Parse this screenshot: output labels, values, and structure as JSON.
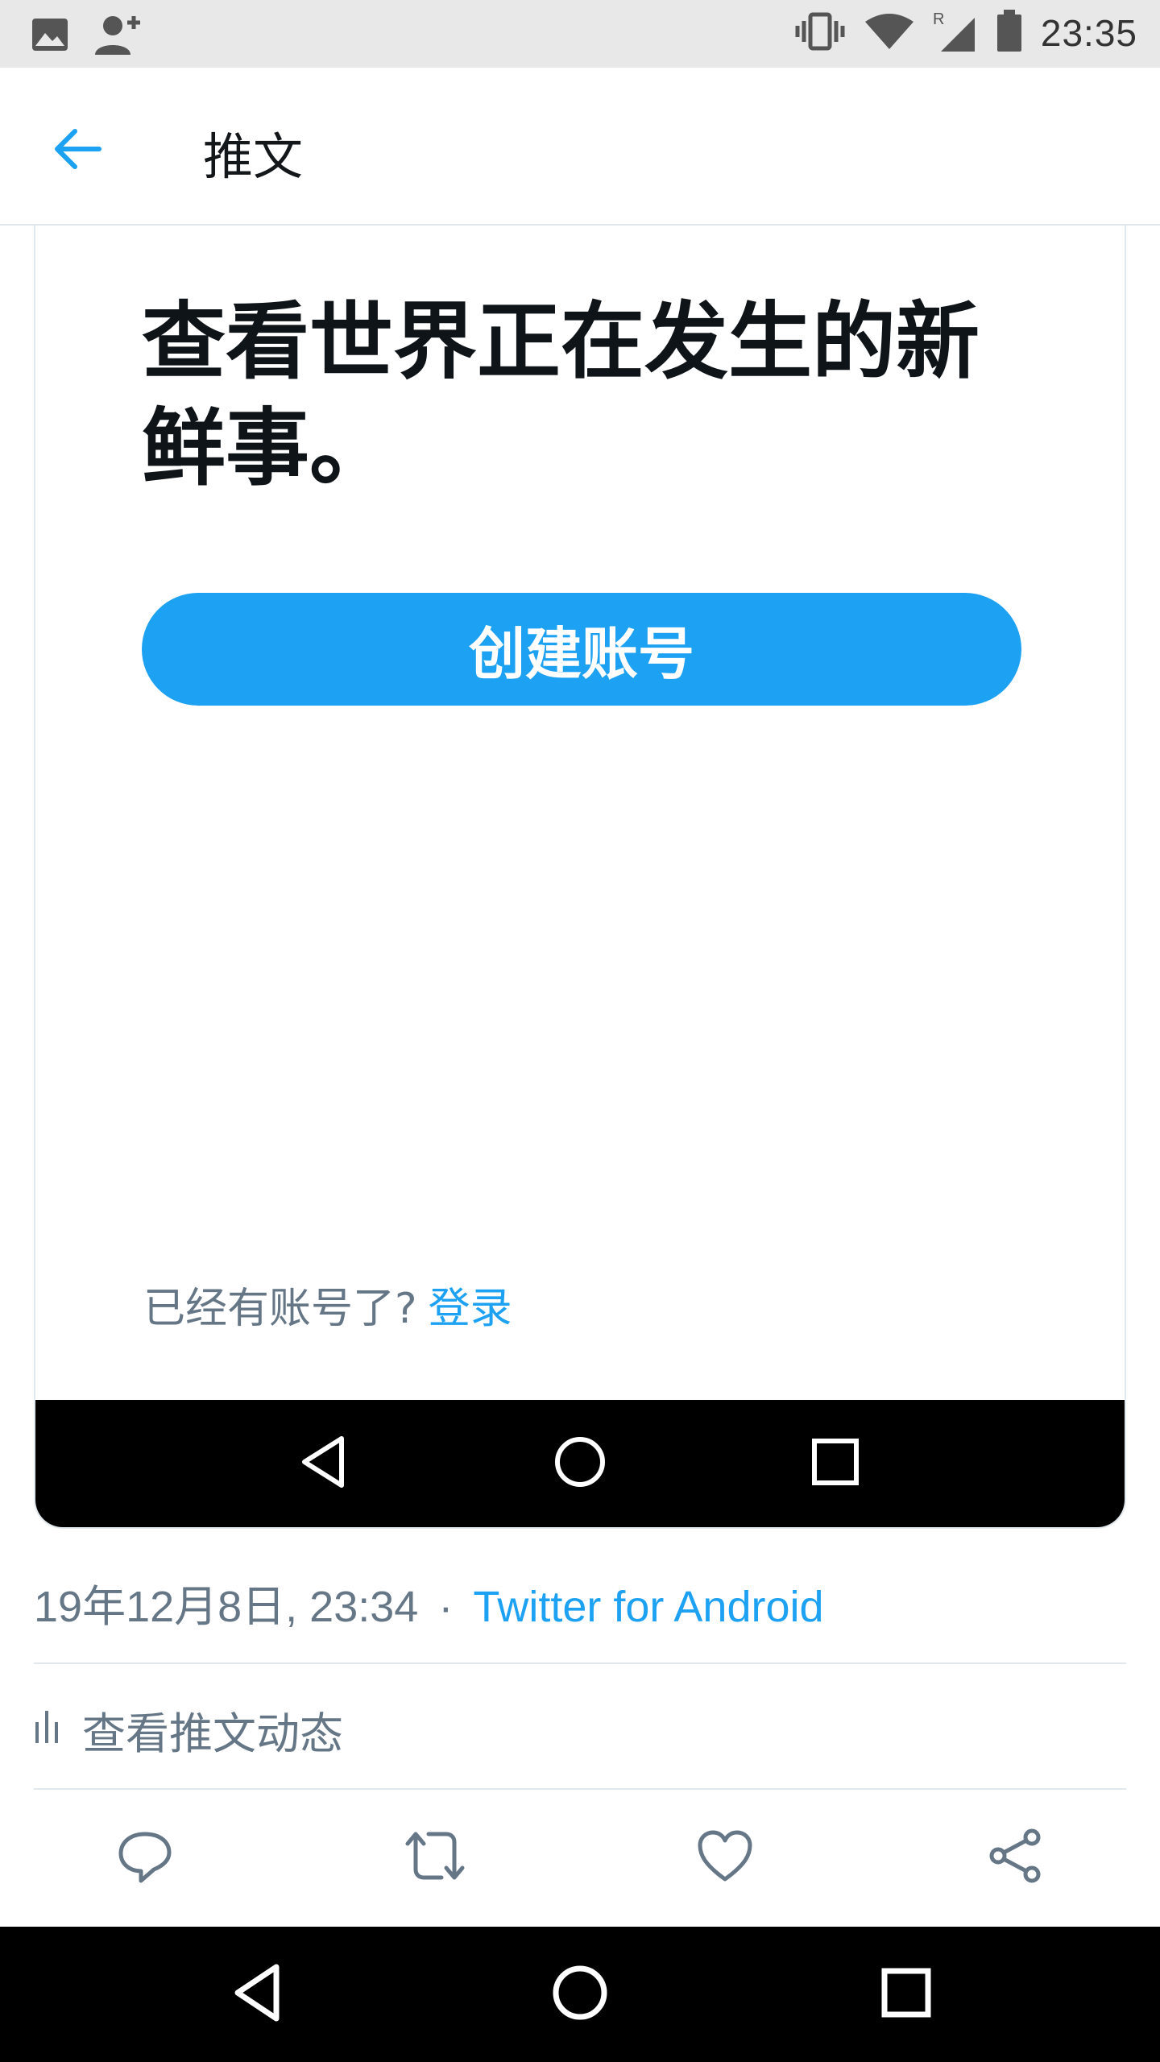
{
  "status_bar": {
    "time": "23:35",
    "icons": [
      "image-icon",
      "add-user-icon",
      "vibrate-icon",
      "wifi-icon",
      "signal-roaming-icon",
      "battery-icon"
    ]
  },
  "app_bar": {
    "back_icon": "arrow-left-icon",
    "title": "推文"
  },
  "card": {
    "headline": "查看世界正在发生的新鲜事。",
    "create_account_label": "创建账号",
    "login_prompt": "已经有账号了?",
    "login_link": "登录",
    "nav_icons": [
      "back-icon",
      "home-icon",
      "recents-icon"
    ]
  },
  "meta": {
    "timestamp": "19年12月8日, 23:34",
    "separator": "·",
    "source": "Twitter for Android"
  },
  "analytics": {
    "label": "查看推文动态"
  },
  "actions": {
    "icons": [
      "reply-icon",
      "retweet-icon",
      "like-icon",
      "share-icon"
    ]
  },
  "colors": {
    "accent": "#1da1f2",
    "secondary_text": "#657786",
    "divider": "#e1e8ed"
  }
}
